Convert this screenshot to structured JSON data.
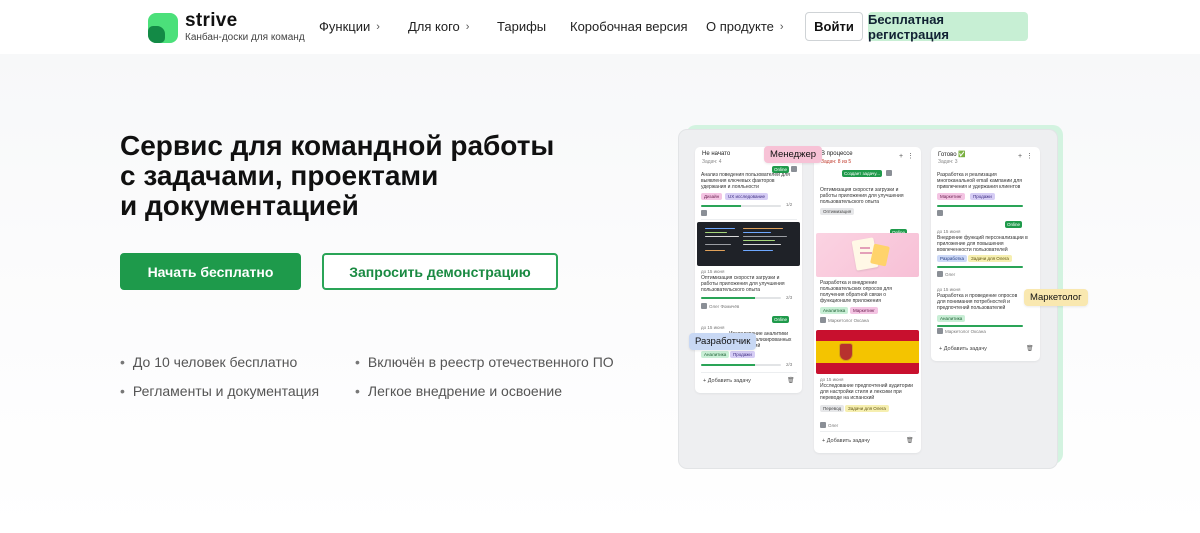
{
  "header": {
    "brand_name": "strive",
    "brand_tagline": "Канбан-доски для команд",
    "nav": [
      {
        "label": "Функции",
        "has_chevron": true
      },
      {
        "label": "Для кого",
        "has_chevron": true
      },
      {
        "label": "Тарифы",
        "has_chevron": false
      },
      {
        "label": "Коробочная версия",
        "has_chevron": false
      },
      {
        "label": "О продукте",
        "has_chevron": true
      }
    ],
    "login_label": "Войти",
    "register_label": "Бесплатная регистрация"
  },
  "hero": {
    "title_lines": [
      "Сервис для командной работы",
      "с задачами, проектами",
      "и документацией"
    ],
    "cta_primary": "Начать бесплатно",
    "cta_secondary": "Запросить демонстрацию",
    "features": [
      "До 10 человек бесплатно",
      "Включён в реестр отечественного ПО",
      "Регламенты и документация",
      "Легкое внедрение и освоение"
    ]
  },
  "board": {
    "columns": [
      {
        "title": "Не начато",
        "count": "Задач: 4",
        "cards": [
          {
            "text": "Анализ поведения пользователей для выявления ключевых факторов удержания и лояльности",
            "tags": [
              "Дизайн",
              "UX исследование"
            ],
            "progress_label": "1/2",
            "progress": 0.5
          },
          {
            "date": "до 15 июня",
            "text": "Оптимизация скорости загрузки и работы приложения для улучшения пользовательского опыта",
            "progress_label": "2/3",
            "progress": 0.67,
            "assignee": "Олег Фомичёв"
          },
          {
            "date": "до 15 июня",
            "text": "Исследование аналитики для персонализированных предложений",
            "tags": [
              "Аналитика",
              "Продажи"
            ],
            "progress_label": "2/3",
            "progress": 0.67
          }
        ],
        "add_label": "Добавить задачу"
      },
      {
        "title": "В процессе",
        "count": "Задач: 8 из 5",
        "badge": "Создает задачу...",
        "cards": [
          {
            "text": "Оптимизация скорости загрузки и работы приложения для улучшения пользовательского опыта",
            "tags": [
              "Оптимизация"
            ]
          },
          {
            "text": "Разработка и внедрение пользовательских опросов для получения обратной связи о функционале приложения",
            "tags": [
              "Аналитика",
              "Маркетинг"
            ],
            "assignee": "Маркетолог Оксана"
          },
          {
            "date": "до 15 июня",
            "text": "Исследование предпочтений аудитории для настройки стиля и лексики при переводе на испанский",
            "tags": [
              "Перевод",
              "Задачи для Олега"
            ],
            "assignee": "Олег"
          }
        ],
        "add_label": "Добавить задачу"
      },
      {
        "title": "Готово ✅",
        "count": "Задач: 3",
        "cards": [
          {
            "text": "Разработка и реализация многоканальной email кампании для привлечения и удержания клиентов",
            "tags": [
              "Маркетинг",
              "Продажи"
            ],
            "progress": 1.0
          },
          {
            "date": "до 15 июня",
            "text": "Внедрение функций персонализации в приложение для повышения вовлеченности пользователей",
            "tags": [
              "Разработка",
              "Задачи для Олега"
            ],
            "assignee": "Олег",
            "progress": 1.0
          },
          {
            "date": "до 15 июня",
            "text": "Разработка и проведение опросов для понимания потребностей и предпочтений пользователей",
            "tags": [
              "Аналитика"
            ],
            "assignee": "Маркетолог Оксана",
            "progress": 1.0
          }
        ],
        "add_label": "Добавить задачу"
      }
    ],
    "online_label": "Online",
    "roles": [
      "Менеджер",
      "Разработчик",
      "Маркетолог"
    ]
  },
  "colors": {
    "primary_green": "#1e9a4b",
    "light_green": "#c7efd4",
    "board_back": "#d3f3e0"
  }
}
